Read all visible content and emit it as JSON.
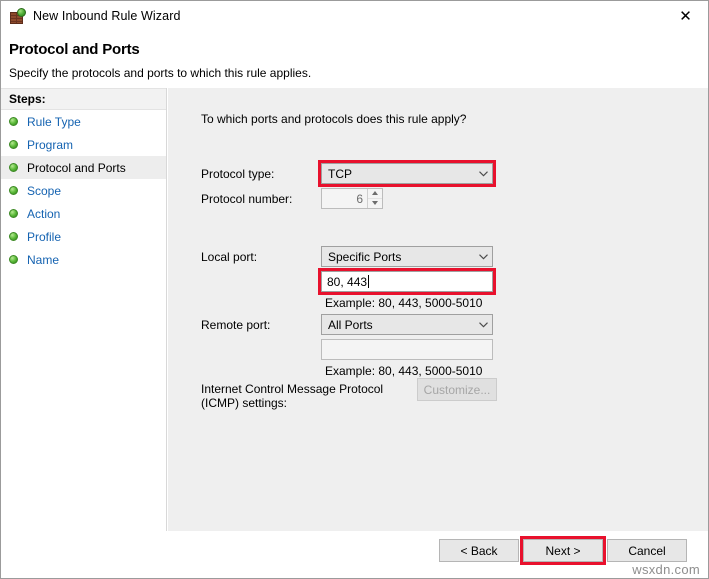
{
  "window": {
    "title": "New Inbound Rule Wizard",
    "icon": "firewall-globe-icon",
    "close_label": "✕"
  },
  "header": {
    "title": "Protocol and Ports",
    "subtitle": "Specify the protocols and ports to which this rule applies."
  },
  "sidebar": {
    "heading": "Steps:",
    "items": [
      {
        "label": "Rule Type",
        "active": false
      },
      {
        "label": "Program",
        "active": false
      },
      {
        "label": "Protocol and Ports",
        "active": true
      },
      {
        "label": "Scope",
        "active": false
      },
      {
        "label": "Action",
        "active": false
      },
      {
        "label": "Profile",
        "active": false
      },
      {
        "label": "Name",
        "active": false
      }
    ]
  },
  "main": {
    "question": "To which ports and protocols does this rule apply?",
    "protocol_type": {
      "label": "Protocol type:",
      "value": "TCP",
      "highlighted": true
    },
    "protocol_number": {
      "label": "Protocol number:",
      "value": "6",
      "enabled": false
    },
    "local_port": {
      "label": "Local port:",
      "value": "Specific Ports",
      "ports_value": "80, 443",
      "ports_highlighted": true,
      "example": "Example: 80, 443, 5000-5010"
    },
    "remote_port": {
      "label": "Remote port:",
      "value": "All Ports",
      "ports_value": "",
      "example": "Example: 80, 443, 5000-5010"
    },
    "icmp": {
      "label_line1": "Internet Control Message Protocol",
      "label_line2": "(ICMP) settings:",
      "button_label": "Customize...",
      "button_enabled": false
    }
  },
  "footer": {
    "back_label": "< Back",
    "next_label": "Next >",
    "cancel_label": "Cancel",
    "next_highlighted": true
  },
  "watermark": "wsxdn.com",
  "colors": {
    "accent_red": "#e8112d",
    "link_blue": "#1563b1",
    "panel_gray": "#efefef"
  }
}
